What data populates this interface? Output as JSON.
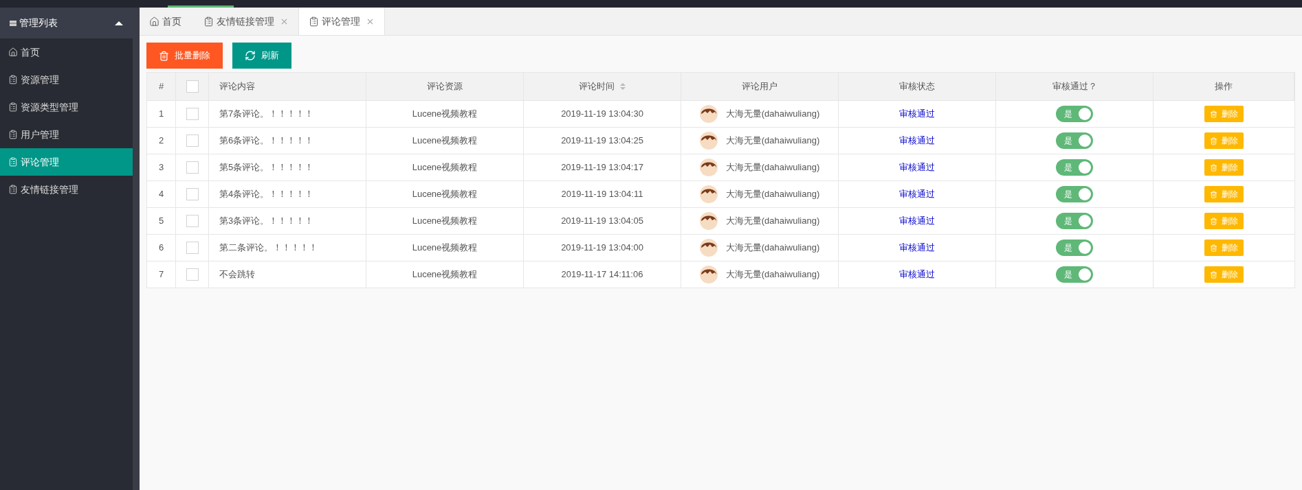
{
  "sidebar": {
    "title": "管理列表",
    "expanded": true,
    "items": [
      {
        "label": "首页",
        "kind": "home",
        "selected": false
      },
      {
        "label": "资源管理",
        "kind": "doc",
        "selected": false
      },
      {
        "label": "资源类型管理",
        "kind": "doc",
        "selected": false
      },
      {
        "label": "用户管理",
        "kind": "doc",
        "selected": false
      },
      {
        "label": "评论管理",
        "kind": "doc",
        "selected": true
      },
      {
        "label": "友情链接管理",
        "kind": "doc",
        "selected": false
      }
    ]
  },
  "tabs": [
    {
      "label": "首页",
      "kind": "home",
      "closable": false,
      "selected": false
    },
    {
      "label": "友情链接管理",
      "kind": "doc",
      "closable": true,
      "selected": false
    },
    {
      "label": "评论管理",
      "kind": "doc",
      "closable": true,
      "selected": true
    }
  ],
  "buttons": [
    {
      "label": "批量删除",
      "kind": "danger"
    },
    {
      "label": "刷新",
      "kind": "refresh"
    }
  ],
  "table": {
    "columns": [
      {
        "label": "#",
        "kind": "text",
        "sortable": false
      },
      {
        "kind": "checkbox",
        "checked": false
      },
      {
        "label": "评论内容",
        "kind": "text",
        "sortable": false
      },
      {
        "label": "评论资源",
        "kind": "text",
        "sortable": false
      },
      {
        "label": "评论时间",
        "kind": "text",
        "sortable": true
      },
      {
        "label": "评论用户",
        "kind": "text",
        "sortable": false
      },
      {
        "label": "审核状态",
        "kind": "text",
        "sortable": false
      },
      {
        "label": "审核通过？",
        "kind": "text",
        "sortable": false
      },
      {
        "label": "操作",
        "kind": "text",
        "sortable": false
      }
    ],
    "rows": [
      {
        "number": "1",
        "checked": false,
        "content": "第7条评论。！！！！！",
        "resource": "Lucene视频教程",
        "time": "2019-11-19 13:04:30",
        "user": "大海无量(dahaiwuliang)",
        "status": "审核通过",
        "pass": {
          "label": "是",
          "on": true
        },
        "action": "删除"
      },
      {
        "number": "2",
        "checked": false,
        "content": "第6条评论。！！！！！",
        "resource": "Lucene视频教程",
        "time": "2019-11-19 13:04:25",
        "user": "大海无量(dahaiwuliang)",
        "status": "审核通过",
        "pass": {
          "label": "是",
          "on": true
        },
        "action": "删除"
      },
      {
        "number": "3",
        "checked": false,
        "content": "第5条评论。！！！！！",
        "resource": "Lucene视频教程",
        "time": "2019-11-19 13:04:17",
        "user": "大海无量(dahaiwuliang)",
        "status": "审核通过",
        "pass": {
          "label": "是",
          "on": true
        },
        "action": "删除"
      },
      {
        "number": "4",
        "checked": false,
        "content": "第4条评论。！！！！！",
        "resource": "Lucene视频教程",
        "time": "2019-11-19 13:04:11",
        "user": "大海无量(dahaiwuliang)",
        "status": "审核通过",
        "pass": {
          "label": "是",
          "on": true
        },
        "action": "删除"
      },
      {
        "number": "5",
        "checked": false,
        "content": "第3条评论。！！！！！",
        "resource": "Lucene视频教程",
        "time": "2019-11-19 13:04:05",
        "user": "大海无量(dahaiwuliang)",
        "status": "审核通过",
        "pass": {
          "label": "是",
          "on": true
        },
        "action": "删除"
      },
      {
        "number": "6",
        "checked": false,
        "content": "第二条评论。！！！！！",
        "resource": "Lucene视频教程",
        "time": "2019-11-19 13:04:00",
        "user": "大海无量(dahaiwuliang)",
        "status": "审核通过",
        "pass": {
          "label": "是",
          "on": true
        },
        "action": "删除"
      },
      {
        "number": "7",
        "checked": false,
        "content": "不会跳转",
        "resource": "Lucene视频教程",
        "time": "2019-11-17 14:11:06",
        "user": "大海无量(dahaiwuliang)",
        "status": "审核通过",
        "pass": {
          "label": "是",
          "on": true
        },
        "action": "删除"
      }
    ]
  }
}
